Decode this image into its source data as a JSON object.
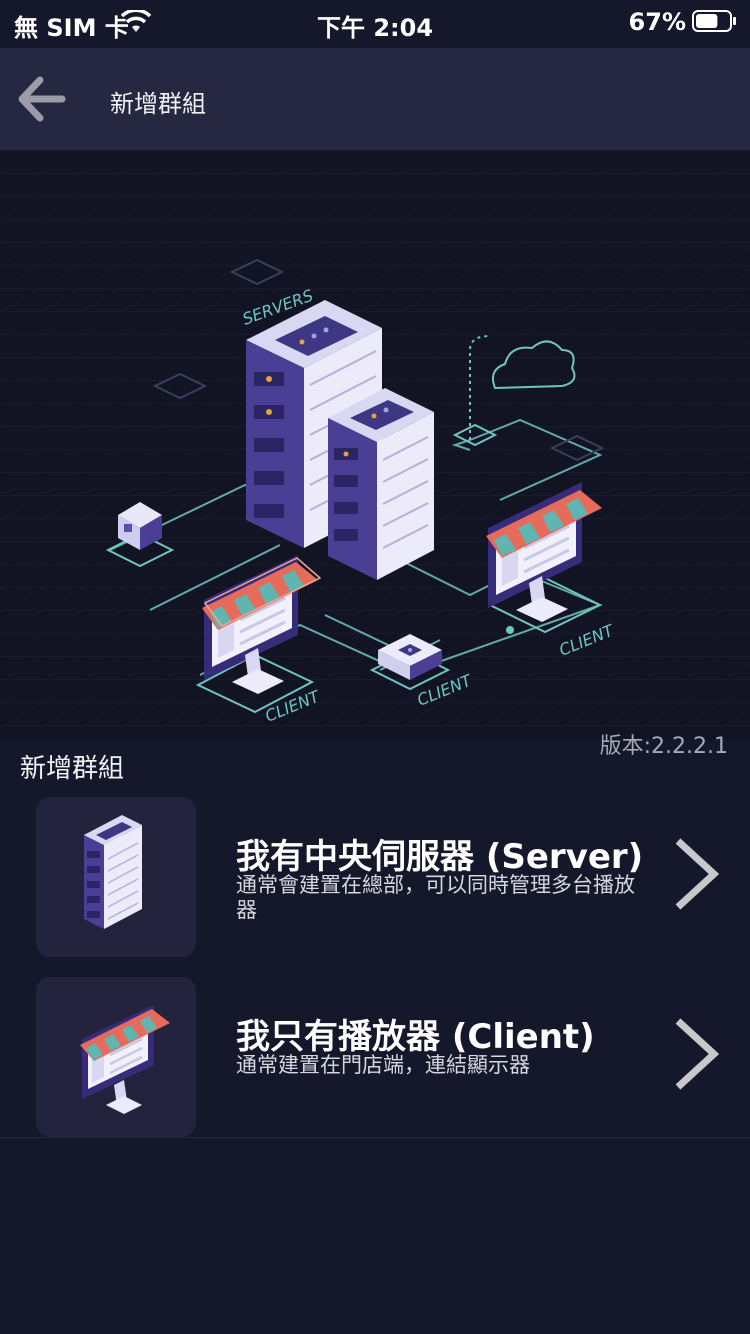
{
  "status_bar": {
    "carrier": "無 SIM 卡",
    "time": "下午 2:04",
    "battery": "67%",
    "battery_level": 0.67
  },
  "nav": {
    "back_icon": "arrow-left-icon",
    "title": "新增群組"
  },
  "hero": {
    "servers_label": "SERVERS",
    "client_label": "CLIENT"
  },
  "version": "版本:2.2.2.1",
  "section_title": "新增群組",
  "options": [
    {
      "icon": "server-rack-icon",
      "title": "我有中央伺服器 (Server)",
      "description": "通常會建置在總部，可以同時管理多台播放器",
      "chevron": "chevron-right-icon"
    },
    {
      "icon": "storefront-monitor-icon",
      "title": "我只有播放器 (Client)",
      "description": "通常建置在門店端，連結顯示器",
      "chevron": "chevron-right-icon"
    }
  ],
  "colors": {
    "background": "#15172a",
    "nav_background": "#262741",
    "card": "#23233d",
    "server_purple": "#5a4fa8",
    "line_teal": "#6ec6c0",
    "awning_red": "#e66b5a",
    "awning_teal": "#5fb5b0"
  }
}
